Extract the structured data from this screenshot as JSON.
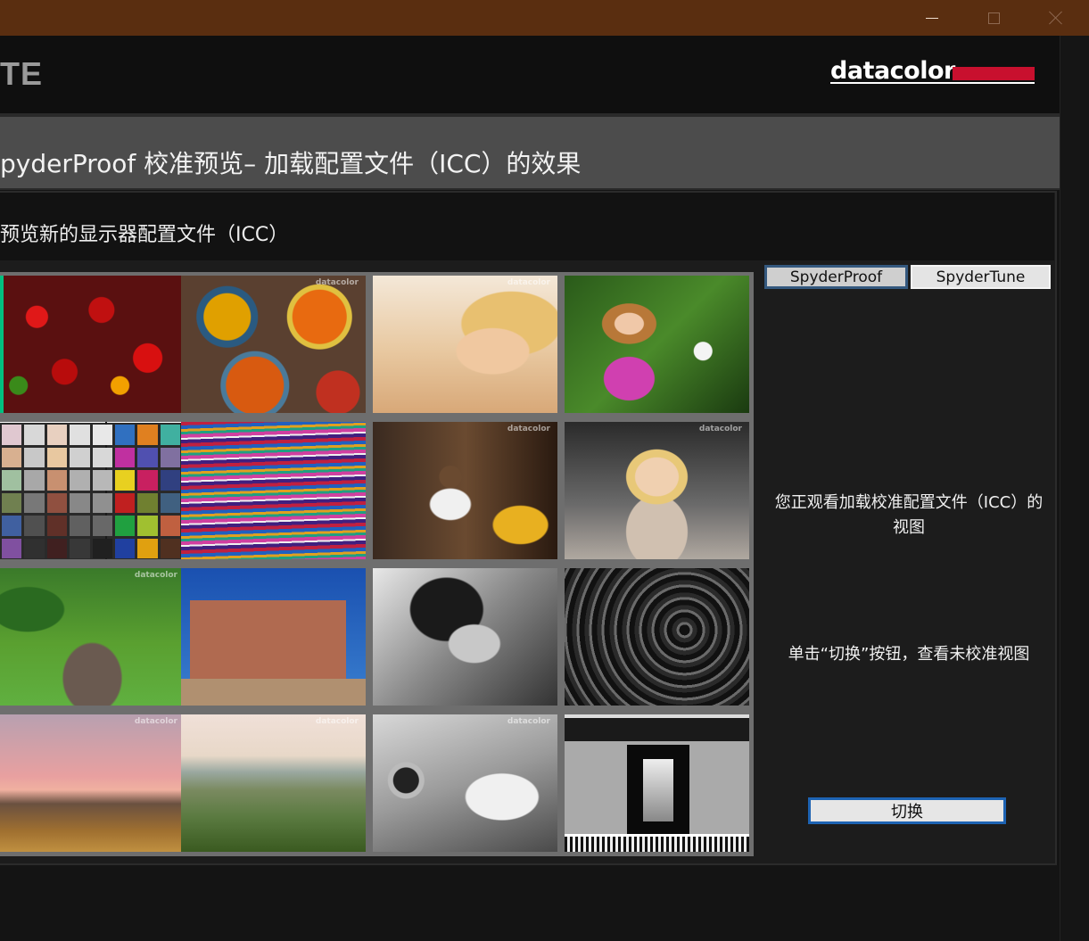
{
  "window": {
    "controls": [
      "minimize",
      "maximize",
      "close"
    ]
  },
  "header": {
    "app_name_fragment": "TE",
    "logo_text": "datacolor"
  },
  "page": {
    "title": "pyderProof 校准预览– 加载配置文件（ICC）的效果",
    "subtitle": "预览新的显示器配置文件（ICC）"
  },
  "thumbnails": [
    {
      "name": "chili-peppers",
      "watermark": ""
    },
    {
      "name": "painted-plates",
      "watermark": "datacolor"
    },
    {
      "name": "blonde-woman",
      "watermark": "datacolor"
    },
    {
      "name": "girl-with-flowers",
      "watermark": ""
    },
    {
      "name": "color-checker",
      "watermark": ""
    },
    {
      "name": "striped-fabric",
      "watermark": ""
    },
    {
      "name": "guitar-player",
      "watermark": "datacolor"
    },
    {
      "name": "marilyn-window",
      "watermark": "datacolor"
    },
    {
      "name": "garden-urn",
      "watermark": "datacolor"
    },
    {
      "name": "adobe-church",
      "watermark": ""
    },
    {
      "name": "bw-portrait",
      "watermark": ""
    },
    {
      "name": "spiral-staircase",
      "watermark": ""
    },
    {
      "name": "sunset-hills",
      "watermark": "datacolor"
    },
    {
      "name": "tuscan-landscape",
      "watermark": "datacolor"
    },
    {
      "name": "bw-scooter",
      "watermark": "datacolor"
    },
    {
      "name": "bw-test-collage",
      "watermark": ""
    }
  ],
  "tabs": {
    "proof_label": "SpyderProof",
    "tune_label": "SpyderTune"
  },
  "messages": {
    "calibrated_view": "您正观看加载校准配置文件（ICC）的视图",
    "instruction": "单击“切换”按钮，查看未校准视图"
  },
  "toggle": {
    "label": "切换"
  }
}
